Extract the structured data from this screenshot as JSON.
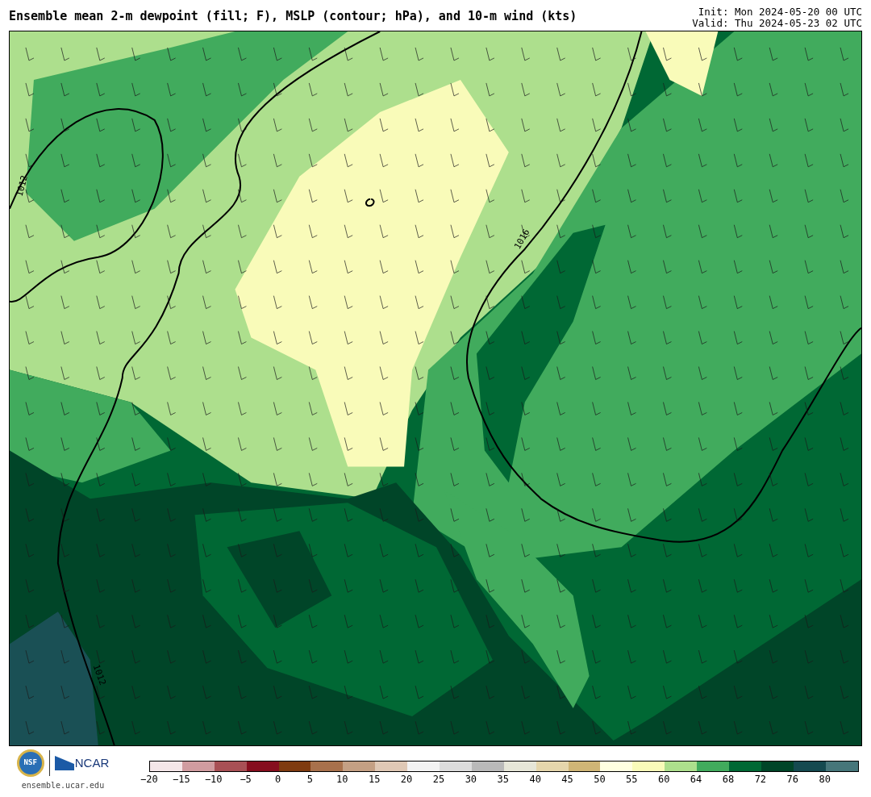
{
  "title": "Ensemble mean 2-m dewpoint (fill; F), MSLP (contour; hPa), and 10-m wind (kts)",
  "init": "Init: Mon 2024-05-20 00 UTC",
  "valid": "Valid: Thu 2024-05-23 02 UTC",
  "contour_labels": [
    {
      "text": "1012"
    },
    {
      "text": "1016"
    },
    {
      "text": "1012"
    }
  ],
  "logos": {
    "nsf": "NSF",
    "ncar": "NCAR",
    "site": "ensemble.ucar.edu"
  },
  "colorbar": {
    "bins": [
      {
        "color": "#f4e6e8"
      },
      {
        "color": "#d09ca0"
      },
      {
        "color": "#a85055"
      },
      {
        "color": "#860e1e"
      },
      {
        "color": "#7f3b10"
      },
      {
        "color": "#a8714c"
      },
      {
        "color": "#c4a084"
      },
      {
        "color": "#dfc8b5"
      },
      {
        "color": "#f2f2f2"
      },
      {
        "color": "#dcdcdc"
      },
      {
        "color": "#b9b9b9"
      },
      {
        "color": "#e6e6d8"
      },
      {
        "color": "#e5d6ac"
      },
      {
        "color": "#cfb576"
      },
      {
        "color": "#ffffe0"
      },
      {
        "color": "#f9fbb9"
      },
      {
        "color": "#addf8d"
      },
      {
        "color": "#41ab5d"
      },
      {
        "color": "#006834"
      },
      {
        "color": "#004528"
      },
      {
        "color": "#154a50"
      },
      {
        "color": "#46767a"
      }
    ],
    "ticks": [
      "−20",
      "−15",
      "−10",
      "−5",
      "0",
      "5",
      "10",
      "15",
      "20",
      "25",
      "30",
      "35",
      "40",
      "45",
      "50",
      "55",
      "60",
      "64",
      "68",
      "72",
      "76",
      "80"
    ]
  }
}
